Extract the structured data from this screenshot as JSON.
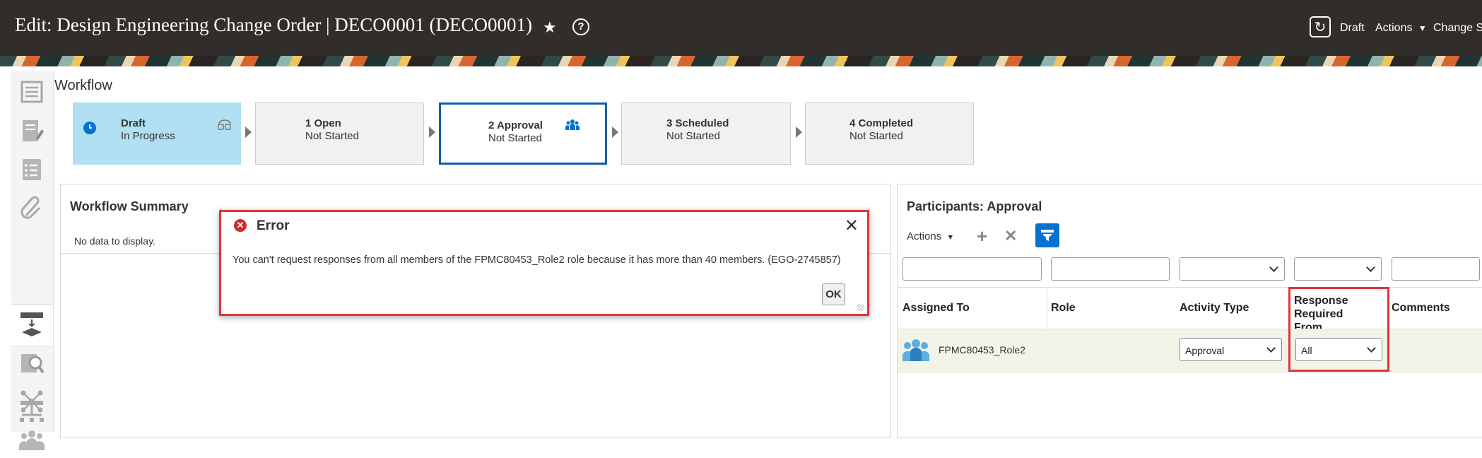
{
  "header": {
    "title": "Edit: Design Engineering Change Order | DECO0001 (DECO0001)",
    "star_icon": "★",
    "help_icon": "?",
    "refresh_icon": "↻",
    "status": "Draft",
    "actions_label": "Actions",
    "caret": "▼",
    "change_status_label": "Change St"
  },
  "rail": {
    "icons": [
      "list-icon",
      "edit-document-icon",
      "checklist-icon",
      "attachment-icon",
      "workflow-icon",
      "search-review-icon",
      "network-icon",
      "people-icon",
      "hierarchy-icon"
    ]
  },
  "workflow": {
    "title": "Workflow",
    "stops": [
      {
        "name": "Draft",
        "status": "In Progress",
        "state": "current"
      },
      {
        "name": "1 Open",
        "status": "Not Started",
        "state": "default"
      },
      {
        "name": "2 Approval",
        "status": "Not Started",
        "state": "selected"
      },
      {
        "name": "3 Scheduled",
        "status": "Not Started",
        "state": "default"
      },
      {
        "name": "4 Completed",
        "status": "Not Started",
        "state": "default"
      }
    ]
  },
  "summary": {
    "title": "Workflow Summary",
    "empty_text": "No data to display."
  },
  "participants": {
    "title": "Participants: Approval",
    "actions_label": "Actions",
    "add_icon": "+",
    "remove_icon": "✕",
    "columns": [
      "Assigned To",
      "Role",
      "Activity Type",
      "Response Required From",
      "Comments"
    ],
    "rows": [
      {
        "assigned_to": "FPMC80453_Role2",
        "role": "",
        "activity_type": "Approval",
        "response_required_from": "All",
        "comments": ""
      }
    ]
  },
  "dialog": {
    "title": "Error",
    "error_icon": "✕",
    "close_icon": "✕",
    "message": "You can't request responses from all members of the FPMC80453_Role2 role because it has more than 40 members. (EGO-2745857)",
    "ok_label": "OK"
  },
  "colors": {
    "header_bg": "#312d2a",
    "current_stop": "#b0e0f2",
    "selected_border": "#0b5fa5",
    "highlight": "#e0353a",
    "toolbar_blue": "#0572ce",
    "row_bg": "#f1f4e6"
  }
}
